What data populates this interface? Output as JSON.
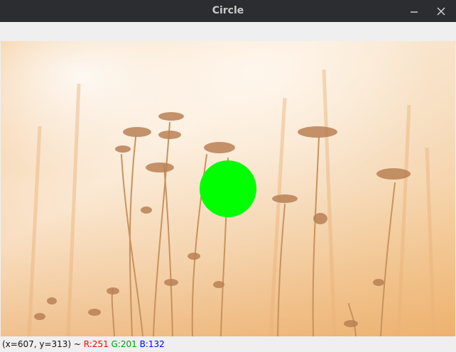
{
  "window": {
    "title": "Circle"
  },
  "controls": {
    "minimize_icon": "minimize-icon",
    "close_icon": "close-icon"
  },
  "image": {
    "description_icon": "photo-dried-grass-flowers",
    "circle_color": "#00ff00",
    "background_tone": "#f6dcbc"
  },
  "status": {
    "coords": "(x=607, y=313) ~ ",
    "r": "R:251",
    "g": "G:201",
    "b": "B:132",
    "r_color": "#ff0000",
    "g_color": "#00a000",
    "b_color": "#0000ff"
  }
}
